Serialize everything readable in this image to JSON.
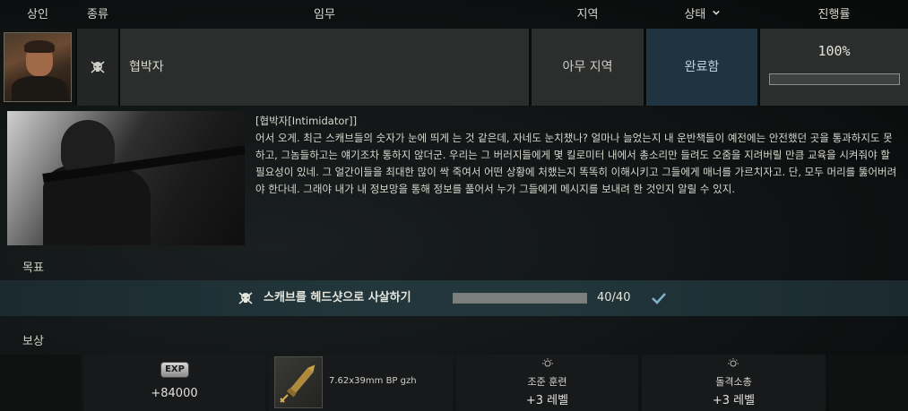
{
  "header": {
    "trader": "상인",
    "type": "종류",
    "mission": "임무",
    "location": "지역",
    "status": "상태",
    "progress": "진행률"
  },
  "quest": {
    "type_icon": "skull-icon",
    "name": "협박자",
    "location": "아무 지역",
    "status": "완료함",
    "progress_text": "100%",
    "progress_fraction": 1.0
  },
  "details": {
    "title": "[협박자[Intimidator]]",
    "description": "어서 오게. 최근 스캐브들의 숫자가 눈에 띄게 는 것 같은데, 자네도 눈치챘나? 얼마나 늘었는지 내 운반책들이 예전에는 안전했던 곳을 통과하지도 못하고, 그놈들하고는 얘기조차 통하지 않더군. 우리는 그 버러지들에게 몇 킬로미터 내에서 총소리만 들려도 오줌을 지려버릴 만큼 교육을 시켜줘야 할 필요성이 있네. 그 얼간이들을 최대한 많이 싹 죽여서 어떤 상황에 처했는지 똑똑히 이해시키고 그들에게 매너를 가르치자고. 단, 모두 머리를 뚫어버려야 한다네. 그래야 내가 내 정보망을 통해 정보를 풀어서 누가 그들에게 메시지를 보내려 한 것인지 알릴 수 있지."
  },
  "objectives": {
    "label": "목표",
    "items": [
      {
        "text": "스캐브를 헤드샷으로 사살하기",
        "count": "40/40",
        "fraction": 1.0,
        "icon": "skull-icon",
        "done_icon": "checkmark-icon"
      }
    ]
  },
  "rewards": {
    "label": "보상",
    "exp_badge": "EXP",
    "exp": "+84000",
    "item_name": "7.62x39mm BP gzh",
    "skills": [
      {
        "name": "조준 훈련",
        "level": "+3 레벨",
        "icon": "lightbulb-icon"
      },
      {
        "name": "돌격소총",
        "level": "+3 레벨",
        "icon": "lightbulb-icon"
      }
    ]
  },
  "colors": {
    "status_bg": "#1f3440",
    "objective_bar": "#22363b",
    "check": "#7fb3c8"
  }
}
